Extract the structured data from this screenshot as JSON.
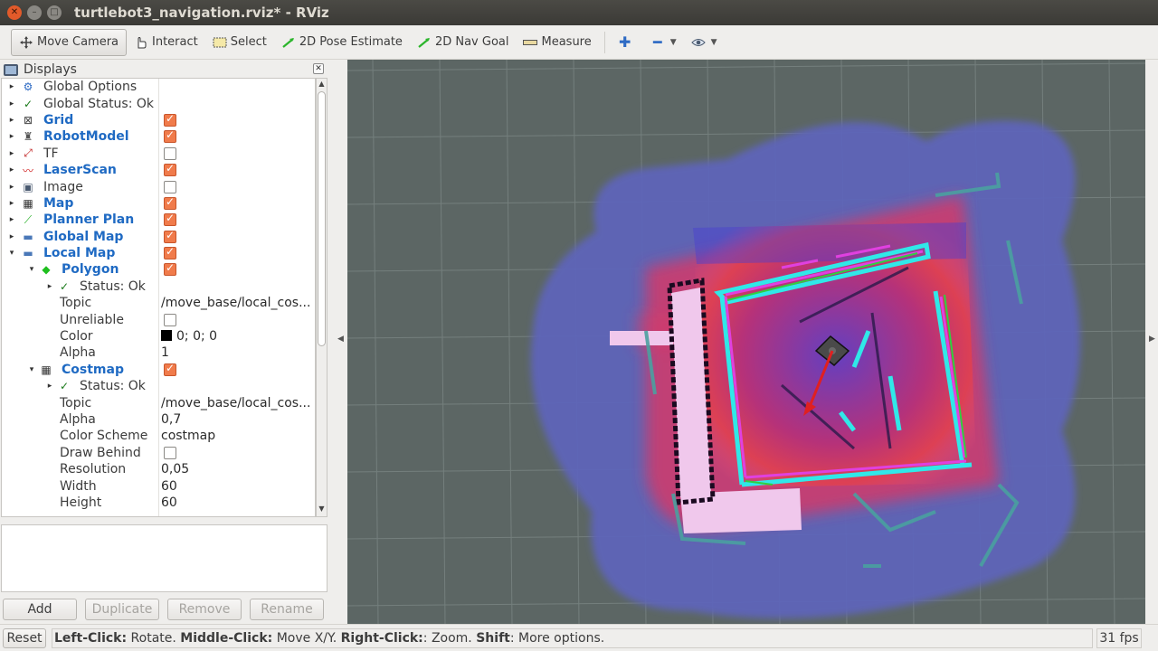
{
  "window": {
    "title": "turtlebot3_navigation.rviz* - RViz",
    "controls": [
      "close-icon",
      "minimize-icon",
      "maximize-icon"
    ]
  },
  "toolbar": {
    "move_camera": "Move Camera",
    "interact": "Interact",
    "select": "Select",
    "pose_estimate": "2D Pose Estimate",
    "nav_goal": "2D Nav Goal",
    "measure": "Measure"
  },
  "displays": {
    "title": "Displays",
    "rows": [
      {
        "label": "Global Options",
        "icon": "gear-icon",
        "style": "normal",
        "level": 0,
        "expander": "▸",
        "checkbox": null
      },
      {
        "label": "Global Status: Ok",
        "icon": "check-icon",
        "style": "normal",
        "level": 0,
        "expander": "▸",
        "checkbox": null
      },
      {
        "label": "Grid",
        "icon": "grid-icon",
        "style": "blue",
        "level": 0,
        "expander": "▸",
        "checkbox": true
      },
      {
        "label": "RobotModel",
        "icon": "robot-icon",
        "style": "blue",
        "level": 0,
        "expander": "▸",
        "checkbox": true
      },
      {
        "label": "TF",
        "icon": "tf-axes-icon",
        "style": "normal",
        "level": 0,
        "expander": "▸",
        "checkbox": false
      },
      {
        "label": "LaserScan",
        "icon": "laser-icon",
        "style": "blue",
        "level": 0,
        "expander": "▸",
        "checkbox": true
      },
      {
        "label": "Image",
        "icon": "image-icon",
        "style": "normal",
        "level": 0,
        "expander": "▸",
        "checkbox": false
      },
      {
        "label": "Map",
        "icon": "map-icon",
        "style": "blue",
        "level": 0,
        "expander": "▸",
        "checkbox": true
      },
      {
        "label": "Planner Plan",
        "icon": "path-icon",
        "style": "blue",
        "level": 0,
        "expander": "▸",
        "checkbox": true
      },
      {
        "label": "Global Map",
        "icon": "folder-icon",
        "style": "blue",
        "level": 0,
        "expander": "▸",
        "checkbox": true
      },
      {
        "label": "Local Map",
        "icon": "folder-icon",
        "style": "blue",
        "level": 0,
        "expander": "▾",
        "checkbox": true
      },
      {
        "label": "Polygon",
        "icon": "polygon-icon",
        "style": "blue",
        "level": 1,
        "expander": "▾",
        "checkbox": true
      },
      {
        "label": "Status: Ok",
        "icon": "check-icon",
        "style": "normal",
        "level": 2,
        "expander": "▸",
        "checkbox": null
      },
      {
        "label": "Topic",
        "style": "prop",
        "level": 2,
        "value": "/move_base/local_cos..."
      },
      {
        "label": "Unreliable",
        "style": "prop",
        "level": 2,
        "checkbox": false
      },
      {
        "label": "Color",
        "style": "prop",
        "level": 2,
        "value": "0; 0; 0",
        "swatch": "#000000"
      },
      {
        "label": "Alpha",
        "style": "prop",
        "level": 2,
        "value": "1"
      },
      {
        "label": "Costmap",
        "icon": "map-icon",
        "style": "blue",
        "level": 1,
        "expander": "▾",
        "checkbox": true
      },
      {
        "label": "Status: Ok",
        "icon": "check-icon",
        "style": "normal",
        "level": 2,
        "expander": "▸",
        "checkbox": null
      },
      {
        "label": "Topic",
        "style": "prop",
        "level": 2,
        "value": "/move_base/local_cos..."
      },
      {
        "label": "Alpha",
        "style": "prop",
        "level": 2,
        "value": "0,7"
      },
      {
        "label": "Color Scheme",
        "style": "prop",
        "level": 2,
        "value": "costmap"
      },
      {
        "label": "Draw Behind",
        "style": "prop",
        "level": 2,
        "checkbox": false
      },
      {
        "label": "Resolution",
        "style": "prop",
        "level": 2,
        "value": "0,05"
      },
      {
        "label": "Width",
        "style": "prop",
        "level": 2,
        "value": "60"
      },
      {
        "label": "Height",
        "style": "prop",
        "level": 2,
        "value": "60"
      }
    ],
    "buttons": {
      "add": "Add",
      "duplicate": "Duplicate",
      "remove": "Remove",
      "rename": "Rename"
    }
  },
  "statusbar": {
    "reset": "Reset",
    "hint_parts": [
      {
        "t": "Left-Click:",
        "b": true
      },
      {
        "t": " Rotate. ",
        "b": false
      },
      {
        "t": "Middle-Click:",
        "b": true
      },
      {
        "t": " Move X/Y. ",
        "b": false
      },
      {
        "t": "Right-Click:",
        "b": true
      },
      {
        "t": ": Zoom. ",
        "b": false
      },
      {
        "t": "Shift",
        "b": true
      },
      {
        "t": ": More options.",
        "b": false
      }
    ],
    "fps": "31 fps"
  },
  "colors": {
    "grid_background": "#5c6664",
    "costmap_blue": "#5a5fb0",
    "costmap_red": "#e0305a",
    "obstacle_cyan": "#30e0e0",
    "lethal_magenta": "#e040e0",
    "path_green": "#20c040",
    "pose_arrow_red": "#e02020",
    "checkbox_orange": "#f07b4b",
    "link_blue": "#1f6ac3"
  }
}
